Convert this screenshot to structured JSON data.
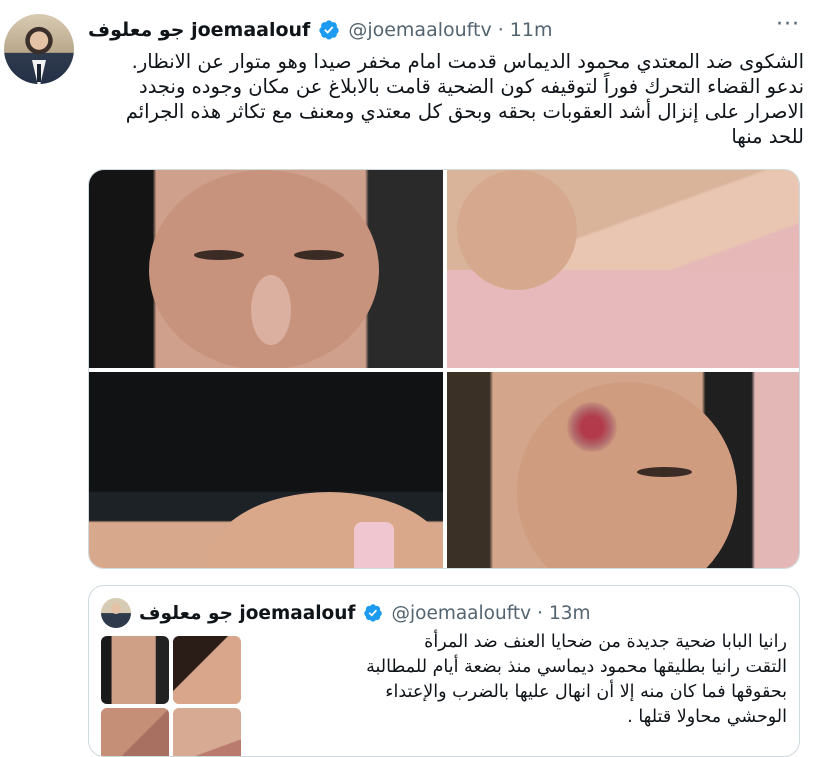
{
  "tweet": {
    "display_name": "جو معلوف joemaalouf",
    "handle": "@joemaalouftv",
    "time": "11m",
    "more_icon": "more-icon",
    "verified_icon": "verified-badge-icon",
    "text_lines": [
      "الشكوى ضد المعتدي محمود الديماس قدمت امام مخفر صيدا وهو متوار عن الانظار.",
      "ندعو القضاء التحرك فوراً لتوقيفه كون الضحية قامت بالابلاغ عن مكان وجوده ونجدد",
      "الاصرار على إنزال أشد العقوبات بحقه وبحق كل معتدي ومعنف مع تكاثر هذه الجرائم",
      "للحد منها"
    ],
    "media_count": 4
  },
  "quoted_tweet": {
    "display_name": "جو معلوف joemaalouf",
    "handle": "@joemaalouftv",
    "time": "13m",
    "text_lines": [
      "رانيا البابا ضحية جديدة من ضحايا العنف ضد المرأة",
      "التقت رانيا بطليقها محمود ديماسي منذ بضعة أيام للمطالبة",
      "بحقوقها فما كان منه إلا أن انهال عليها بالضرب والإعتداء",
      "الوحشي محاولا قتلها ."
    ],
    "media_count": 4
  },
  "colors": {
    "text_primary": "#0f1419",
    "text_secondary": "#536471",
    "verified": "#1d9bf0",
    "border": "#cfd9de"
  }
}
